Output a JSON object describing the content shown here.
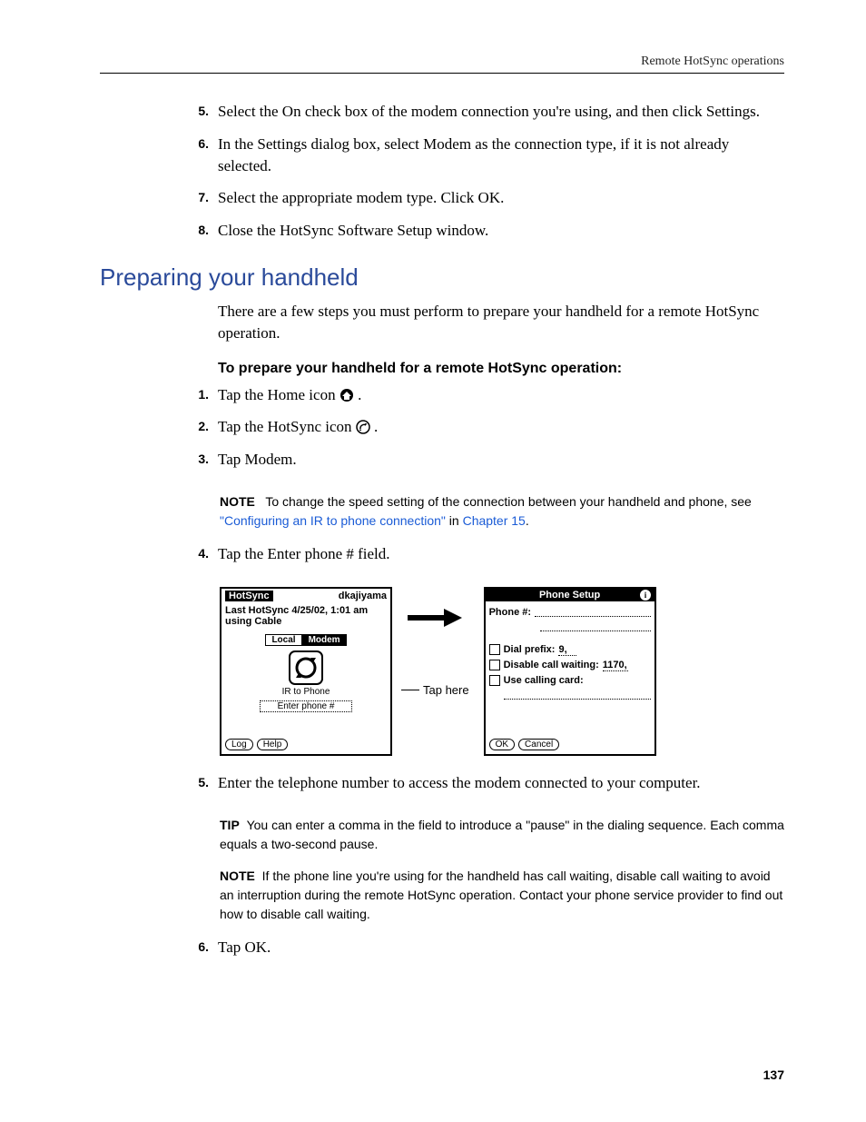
{
  "header": "Remote HotSync operations",
  "page_number": "137",
  "top_steps": [
    {
      "num": "5.",
      "text": "Select the On check box of the modem connection you're using, and then click Settings."
    },
    {
      "num": "6.",
      "text": "In the Settings dialog box, select Modem as the connection type, if it is not already selected."
    },
    {
      "num": "7.",
      "text": "Select the appropriate modem type. Click OK."
    },
    {
      "num": "8.",
      "text": "Close the HotSync Software Setup window."
    }
  ],
  "section_title": "Preparing your handheld",
  "section_intro": "There are a few steps you must perform to prepare your handheld for a remote HotSync operation.",
  "proc_title": "To prepare your handheld for a remote HotSync operation:",
  "proc_steps_a": [
    {
      "num": "1.",
      "text": "Tap the Home icon ",
      "icon": "home"
    },
    {
      "num": "2.",
      "text": "Tap the HotSync icon ",
      "icon": "hotsync"
    },
    {
      "num": "3.",
      "text": "Tap Modem."
    }
  ],
  "note1": {
    "label": "NOTE",
    "pre": "To change the speed setting of the connection between your handheld and phone, see ",
    "link1": "\"Configuring an IR to phone connection\"",
    "mid": " in ",
    "link2": "Chapter 15",
    "post": "."
  },
  "step4": {
    "num": "4.",
    "text": "Tap the Enter phone # field."
  },
  "hotsync_screen": {
    "title": "HotSync",
    "user": "dkajiyama",
    "last": "Last HotSync 4/25/02, 1:01 am using Cable",
    "tabs": {
      "local": "Local",
      "modem": "Modem"
    },
    "sub": "IR to Phone",
    "field": "Enter phone #",
    "btn_log": "Log",
    "btn_help": "Help"
  },
  "tap_here": "Tap here",
  "phone_screen": {
    "title": "Phone Setup",
    "phone_label": "Phone #:",
    "dial_prefix": "Dial prefix:",
    "dial_prefix_val": "9,",
    "disable_cw": "Disable call waiting:",
    "disable_cw_val": "1170,",
    "calling_card": "Use calling card:",
    "btn_ok": "OK",
    "btn_cancel": "Cancel"
  },
  "step5": {
    "num": "5.",
    "text": "Enter the telephone number to access the modem connected to your computer."
  },
  "tip": {
    "label": "TIP",
    "text": "You can enter a comma in the field to introduce a \"pause\" in the dialing sequence. Each comma equals a two-second pause."
  },
  "note2": {
    "label": "NOTE",
    "text": "If the phone line you're using for the handheld has call waiting, disable call waiting to avoid an interruption during the remote HotSync operation. Contact your phone service provider to find out how to disable call waiting."
  },
  "step6": {
    "num": "6.",
    "text": "Tap OK."
  }
}
